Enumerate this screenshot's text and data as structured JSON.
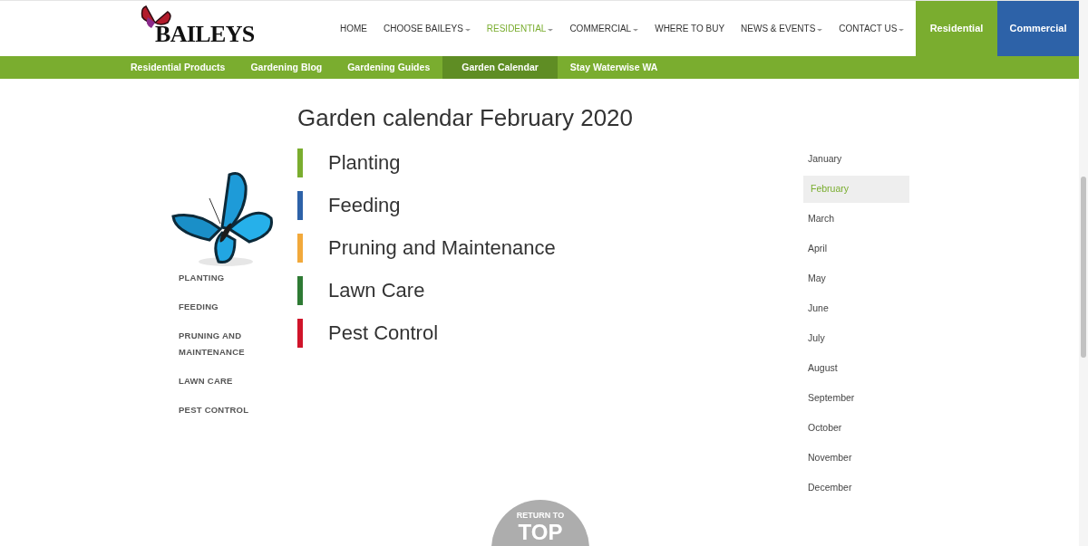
{
  "logo": {
    "text": "BAILEYS"
  },
  "nav": [
    {
      "label": "HOME",
      "selected": false,
      "dropdown": false
    },
    {
      "label": "CHOOSE BAILEYS",
      "selected": false,
      "dropdown": true
    },
    {
      "label": "RESIDENTIAL",
      "selected": true,
      "dropdown": true
    },
    {
      "label": "COMMERCIAL",
      "selected": false,
      "dropdown": true
    },
    {
      "label": "WHERE TO BUY",
      "selected": false,
      "dropdown": false
    },
    {
      "label": "NEWS & EVENTS",
      "selected": false,
      "dropdown": true
    },
    {
      "label": "CONTACT US",
      "selected": false,
      "dropdown": true
    }
  ],
  "site_switch": [
    {
      "label": "Residential",
      "color": "#7aad2f"
    },
    {
      "label": "Commercial",
      "color": "#2d62a8"
    }
  ],
  "subnav": [
    {
      "label": "Residential Products",
      "selected": false
    },
    {
      "label": "Gardening Blog",
      "selected": false
    },
    {
      "label": "Gardening Guides",
      "selected": false
    },
    {
      "label": "Garden Calendar",
      "selected": true
    },
    {
      "label": "Stay Waterwise WA",
      "selected": false
    }
  ],
  "title": "Garden calendar February 2020",
  "categories": [
    {
      "label": "Planting",
      "color": "#7aad2f"
    },
    {
      "label": "Feeding",
      "color": "#2d62a8"
    },
    {
      "label": "Pruning and Maintenance",
      "color": "#f2a93b"
    },
    {
      "label": "Lawn Care",
      "color": "#2e7a34"
    },
    {
      "label": "Pest Control",
      "color": "#d0142a"
    }
  ],
  "sidebar": [
    "PLANTING",
    "FEEDING",
    "PRUNING AND MAINTENANCE",
    "LAWN CARE",
    "PEST CONTROL"
  ],
  "months": [
    {
      "label": "January",
      "selected": false
    },
    {
      "label": "February",
      "selected": true
    },
    {
      "label": "March",
      "selected": false
    },
    {
      "label": "April",
      "selected": false
    },
    {
      "label": "May",
      "selected": false
    },
    {
      "label": "June",
      "selected": false
    },
    {
      "label": "July",
      "selected": false
    },
    {
      "label": "August",
      "selected": false
    },
    {
      "label": "September",
      "selected": false
    },
    {
      "label": "October",
      "selected": false
    },
    {
      "label": "November",
      "selected": false
    },
    {
      "label": "December",
      "selected": false
    }
  ],
  "return_to_top": {
    "line_1": "RETURN TO",
    "line_2": "TOP"
  }
}
